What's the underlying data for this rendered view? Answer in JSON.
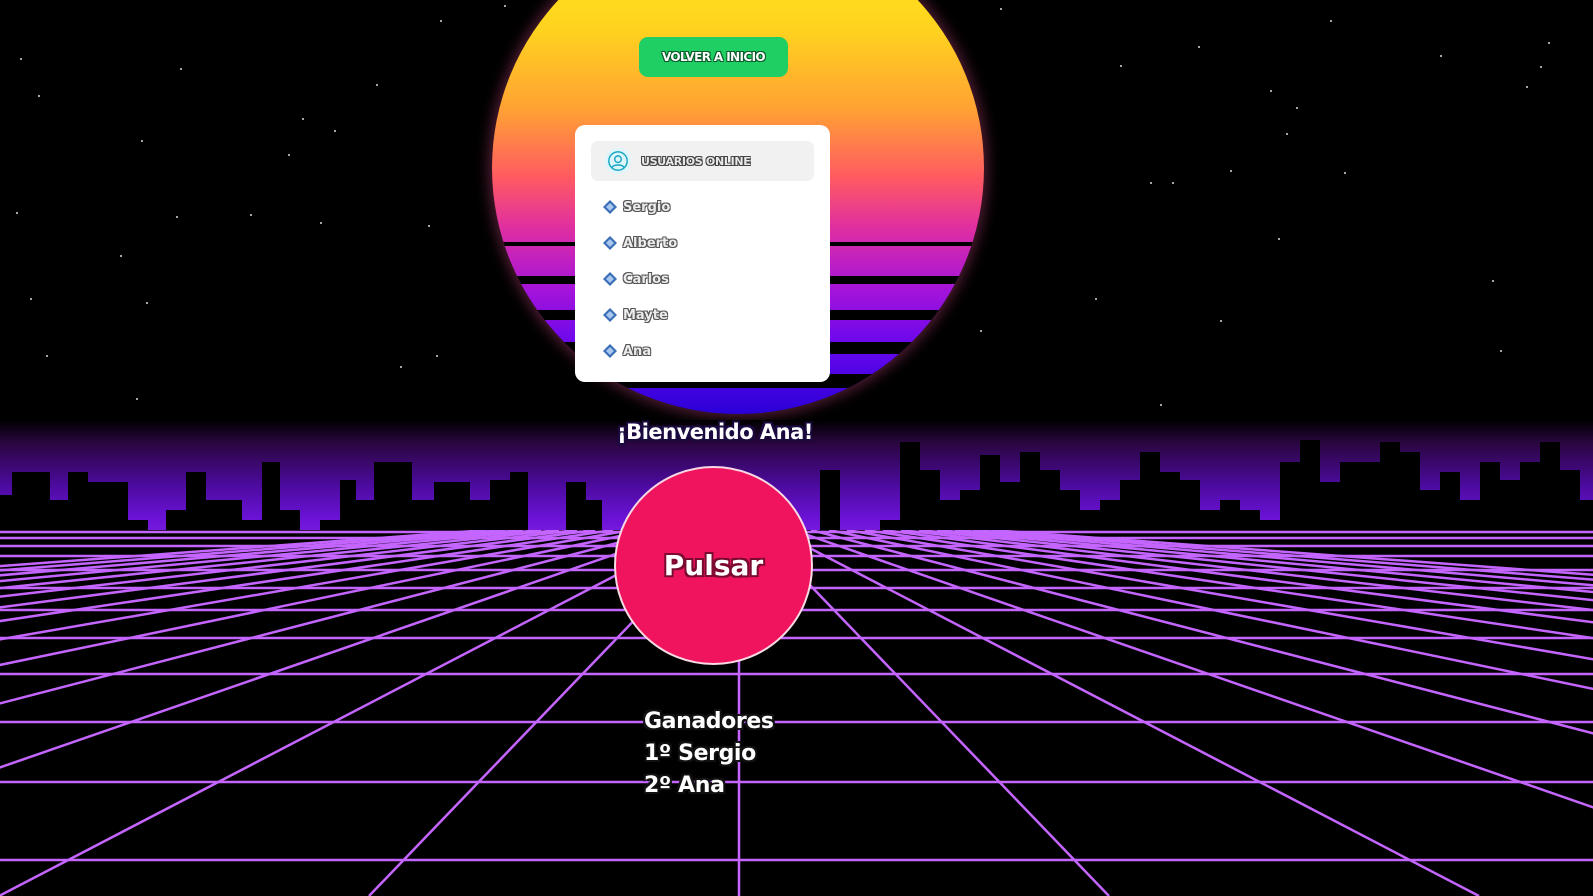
{
  "back_button": {
    "label": "VOLVER A INICIO"
  },
  "online_users": {
    "title": "USUARIOS ONLINE",
    "icon": "user-circle-icon",
    "items": [
      {
        "name": "Sergio"
      },
      {
        "name": "Alberto"
      },
      {
        "name": "Carlos"
      },
      {
        "name": "Mayte"
      },
      {
        "name": "Ana"
      }
    ]
  },
  "welcome": "¡Bienvenido Ana!",
  "press_button": {
    "label": "Pulsar"
  },
  "winners": {
    "title": "Ganadores",
    "items": [
      "1º Sergio",
      "2º Ana"
    ]
  },
  "colors": {
    "back_button": "#1fcf63",
    "press_button": "#f0145f",
    "grid": "#c565ff",
    "horizon": "#6a12d6"
  }
}
